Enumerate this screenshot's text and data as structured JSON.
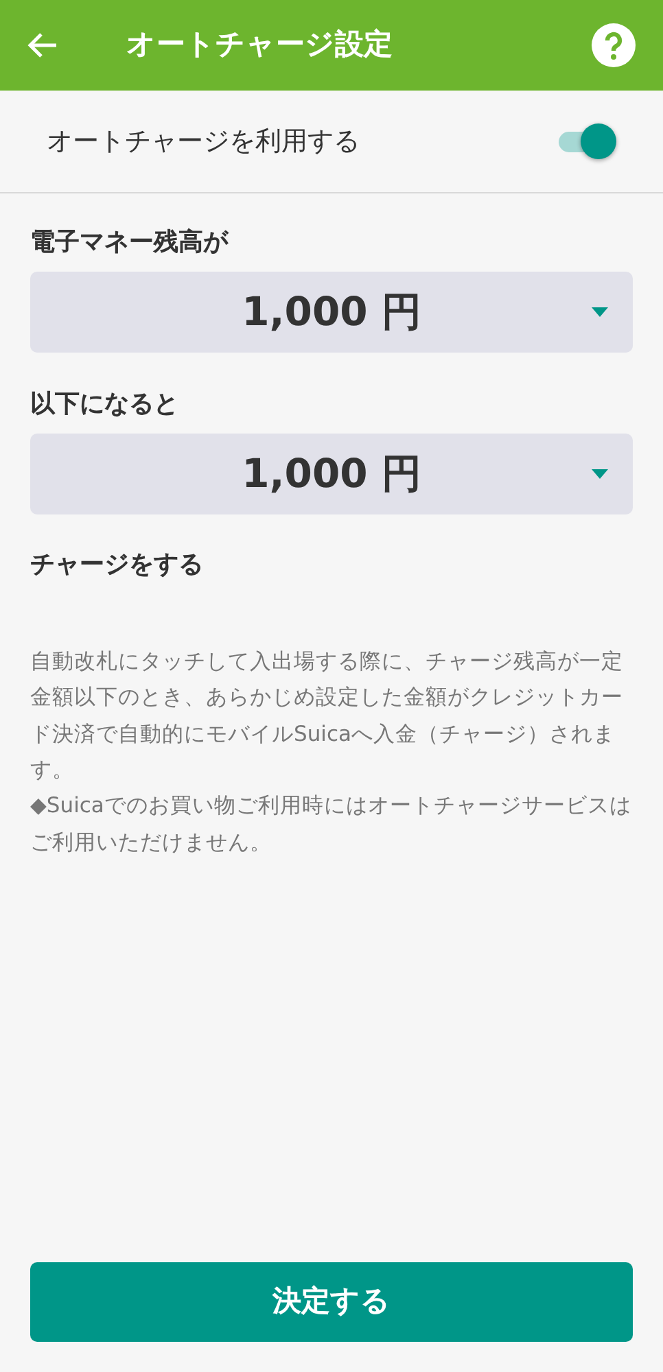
{
  "header": {
    "title": "オートチャージ設定"
  },
  "toggle": {
    "label": "オートチャージを利用する",
    "on": true
  },
  "threshold_label": "電子マネー残高が",
  "threshold": {
    "value": "1,000 円"
  },
  "amount_label": "以下になると",
  "amount": {
    "value": "1,000 円"
  },
  "action_label": "チャージをする",
  "notes": [
    "自動改札にタッチして入出場する際に、チャージ残高が一定金額以下のとき、あらかじめ設定した金額がクレジットカード決済で自動的にモバイルSuicaへ入金（チャージ）されます。",
    "◆Suicaでのお買い物ご利用時にはオートチャージサービスはご利用いただけません。"
  ],
  "submit_button": "決定する"
}
